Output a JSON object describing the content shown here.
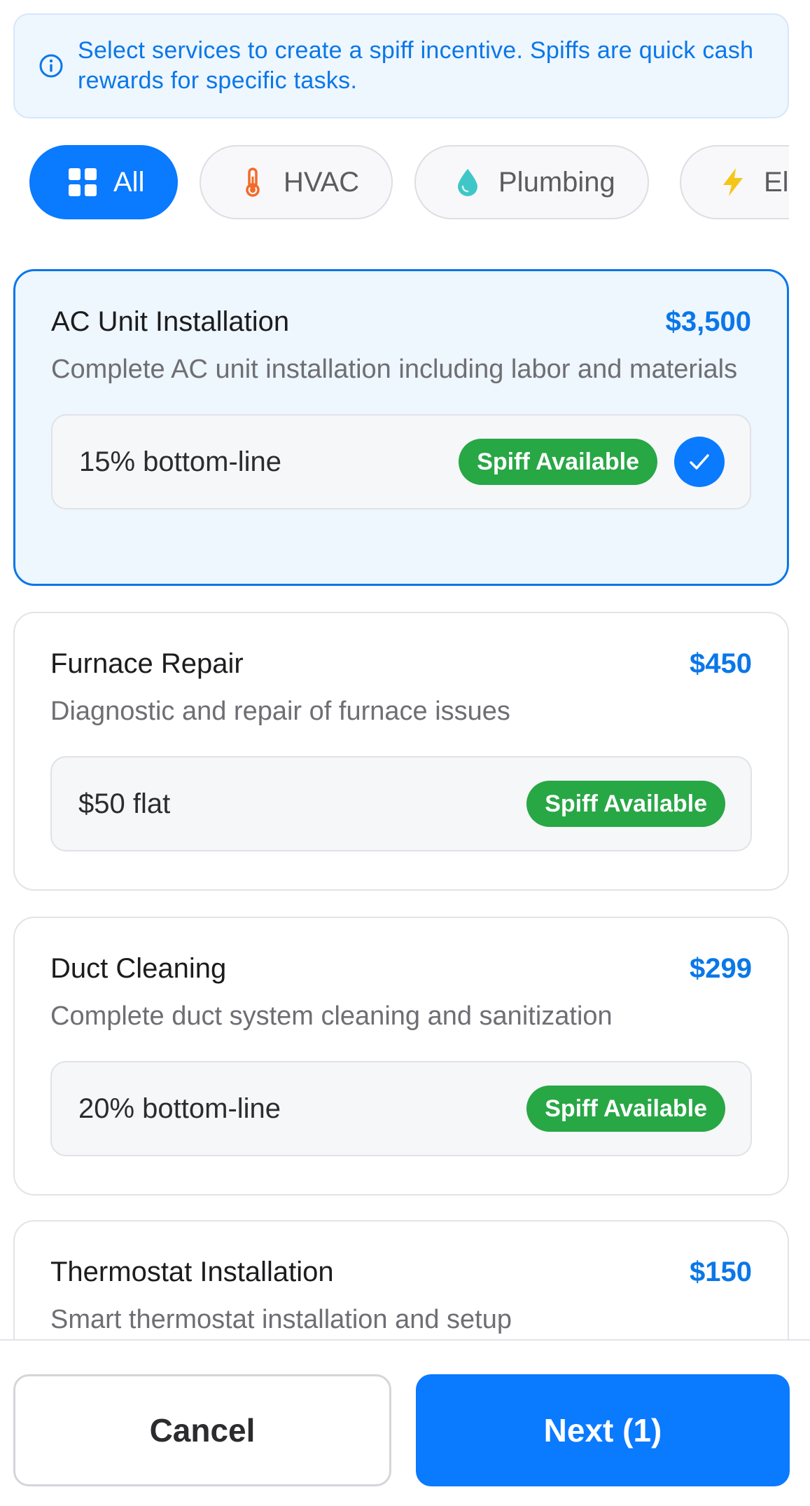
{
  "banner": {
    "icon": "info-icon",
    "text": "Select services to create a spiff incentive. Spiffs are quick cash rewards for specific tasks."
  },
  "filters": [
    {
      "label": "All",
      "icon": "grid-icon",
      "active": true
    },
    {
      "label": "HVAC",
      "icon": "thermometer-icon",
      "active": false
    },
    {
      "label": "Plumbing",
      "icon": "water-drop-icon",
      "active": false
    },
    {
      "label": "Electrical",
      "icon": "lightning-icon",
      "active": false
    }
  ],
  "services": [
    {
      "name": "AC Unit Installation",
      "price": "$3,500",
      "description": "Complete AC unit installation including labor and materials",
      "spiff_rule": "15% bottom-line",
      "badge": "Spiff Available",
      "selected": true
    },
    {
      "name": "Furnace Repair",
      "price": "$450",
      "description": "Diagnostic and repair of furnace issues",
      "spiff_rule": "$50 flat",
      "badge": "Spiff Available",
      "selected": false
    },
    {
      "name": "Duct Cleaning",
      "price": "$299",
      "description": "Complete duct system cleaning and sanitization",
      "spiff_rule": "20% bottom-line",
      "badge": "Spiff Available",
      "selected": false
    },
    {
      "name": "Thermostat Installation",
      "price": "$150",
      "description": "Smart thermostat installation and setup",
      "spiff_rule": "",
      "badge": "",
      "selected": false
    }
  ],
  "actions": {
    "cancel_label": "Cancel",
    "next_label": "Next (1)"
  },
  "colors": {
    "accent": "#0a7aff",
    "badge_green": "#28a745",
    "selected_bg": "#eef6fe"
  }
}
